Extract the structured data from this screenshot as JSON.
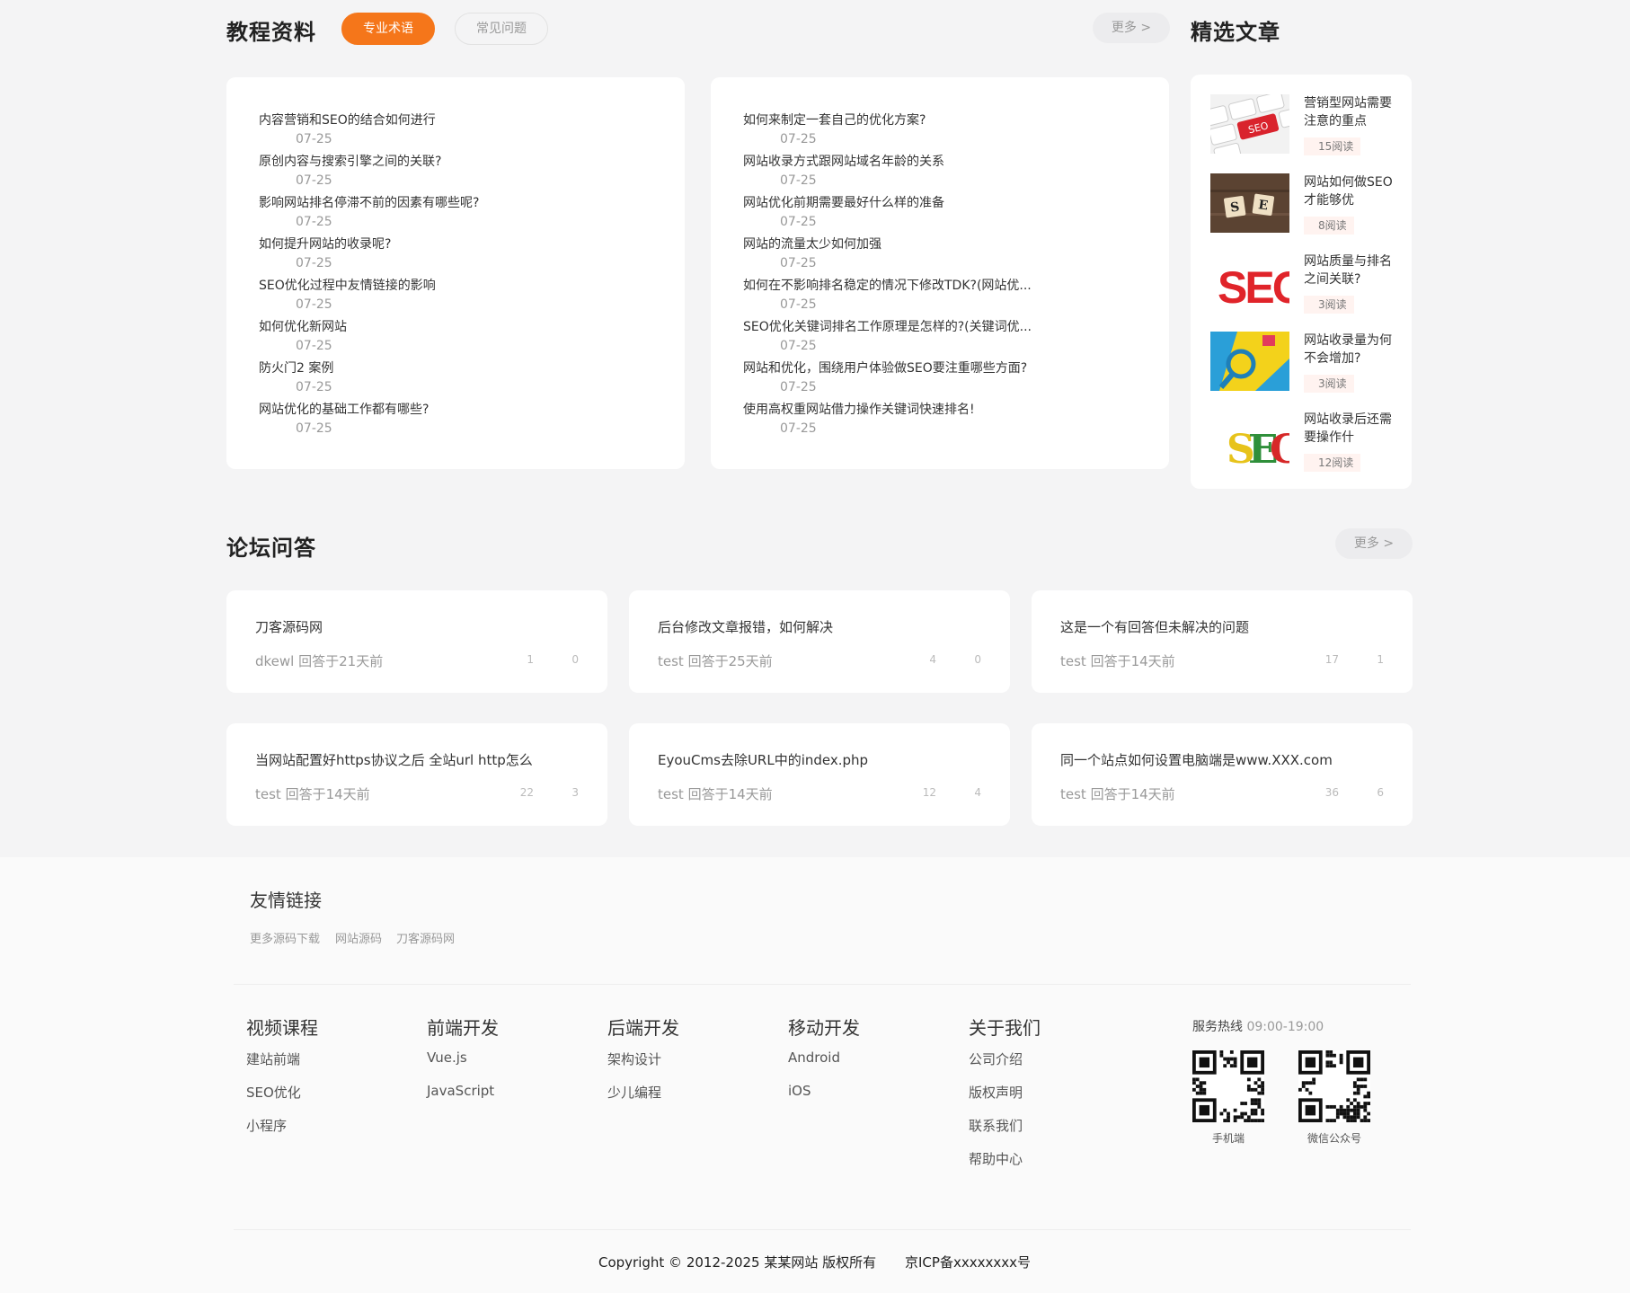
{
  "tutorial": {
    "title": "教程资料",
    "tabs": [
      "专业术语",
      "常见问题"
    ],
    "more": "更多 >",
    "left_list": [
      {
        "title": "内容营销和SEO的结合如何进行",
        "date": "07-25"
      },
      {
        "title": "原创内容与搜索引擎之间的关联?",
        "date": "07-25"
      },
      {
        "title": "影响网站排名停滞不前的因素有哪些呢?",
        "date": "07-25"
      },
      {
        "title": "如何提升网站的收录呢?",
        "date": "07-25"
      },
      {
        "title": "SEO优化过程中友情链接的影响",
        "date": "07-25"
      },
      {
        "title": "如何优化新网站",
        "date": "07-25"
      },
      {
        "title": "防火门2 案例",
        "date": "07-25"
      },
      {
        "title": "网站优化的基础工作都有哪些?",
        "date": "07-25"
      }
    ],
    "right_list": [
      {
        "title": "如何来制定一套自己的优化方案?",
        "date": "07-25"
      },
      {
        "title": "网站收录方式跟网站域名年龄的关系",
        "date": "07-25"
      },
      {
        "title": "网站优化前期需要最好什么样的准备",
        "date": "07-25"
      },
      {
        "title": "网站的流量太少如何加强",
        "date": "07-25"
      },
      {
        "title": "如何在不影响排名稳定的情况下修改TDK?(网站优...",
        "date": "07-25"
      },
      {
        "title": "SEO优化关键词排名工作原理是怎样的?(关键词优...",
        "date": "07-25"
      },
      {
        "title": "网站和优化，围绕用户体验做SEO要注重哪些方面?",
        "date": "07-25"
      },
      {
        "title": "使用高权重网站借力操作关键词快速排名!",
        "date": "07-25"
      }
    ]
  },
  "featured": {
    "title": "精选文章",
    "items": [
      {
        "title": "营销型网站需要注意的重点",
        "reads": "15阅读",
        "thumb": "keyboard-seo-key"
      },
      {
        "title": "网站如何做SEO才能够优",
        "reads": "8阅读",
        "thumb": "wooden-s-e-tiles"
      },
      {
        "title": "网站质量与排名之间关联?",
        "reads": "3阅读",
        "thumb": "red-seo-letters"
      },
      {
        "title": "网站收录量为何不会增加?",
        "reads": "3阅读",
        "thumb": "magnifier-on-color"
      },
      {
        "title": "网站收录后还需要操作什",
        "reads": "12阅读",
        "thumb": "colorful-seo-letters"
      }
    ]
  },
  "forum": {
    "title": "论坛问答",
    "more": "更多 >",
    "questions": [
      {
        "title": "刀客源码网",
        "meta": "dkewl 回答于21天前",
        "n1": "1",
        "n2": "0"
      },
      {
        "title": "后台修改文章报错，如何解决",
        "meta": "test 回答于25天前",
        "n1": "4",
        "n2": "0"
      },
      {
        "title": "这是一个有回答但未解决的问题",
        "meta": "test 回答于14天前",
        "n1": "17",
        "n2": "1"
      },
      {
        "title": "当网站配置好https协议之后 全站url http怎么",
        "meta": "test 回答于14天前",
        "n1": "22",
        "n2": "3"
      },
      {
        "title": "EyouCms去除URL中的index.php",
        "meta": "test 回答于14天前",
        "n1": "12",
        "n2": "4"
      },
      {
        "title": "同一个站点如何设置电脑端是www.XXX.com",
        "meta": "test 回答于14天前",
        "n1": "36",
        "n2": "6"
      }
    ]
  },
  "footer": {
    "links_title": "友情链接",
    "friend_links": [
      "更多源码下载",
      "网站源码",
      "刀客源码网"
    ],
    "columns": [
      {
        "title": "视频课程",
        "links": [
          "建站前端",
          "SEO优化",
          "小程序"
        ]
      },
      {
        "title": "前端开发",
        "links": [
          "Vue.js",
          "JavaScript"
        ]
      },
      {
        "title": "后端开发",
        "links": [
          "架构设计",
          "少儿编程"
        ]
      },
      {
        "title": "移动开发",
        "links": [
          "Android",
          "iOS"
        ]
      },
      {
        "title": "关于我们",
        "links": [
          "公司介绍",
          "版权声明",
          "联系我们",
          "帮助中心"
        ]
      }
    ],
    "hotline_label": "服务热线",
    "hotline_hours": "09:00-19:00",
    "qr_labels": [
      "手机端",
      "微信公众号"
    ],
    "copyright": "Copyright © 2012-2025 某某网站 版权所有",
    "icp": "京ICP备xxxxxxxx号"
  },
  "colors": {
    "accent": "#f5761a",
    "background": "#f4f4f5",
    "card": "#ffffff"
  }
}
